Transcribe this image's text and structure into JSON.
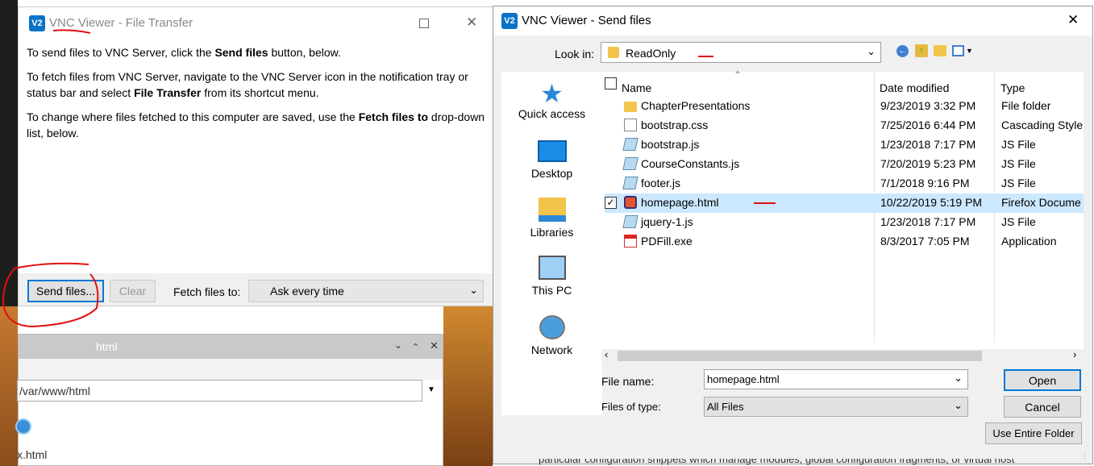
{
  "file_transfer": {
    "title": "VNC Viewer - File Transfer",
    "p1_pre": "To send files to VNC Server, click the ",
    "p1_bold": "Send files",
    "p1_post": " button, below.",
    "p2_pre": "To fetch files from VNC Server, navigate to the VNC Server icon in the notification tray or status bar and select ",
    "p2_bold": "File Transfer",
    "p2_post": " from its shortcut menu.",
    "p3_pre": "To change where files fetched to this computer are saved, use the ",
    "p3_bold": "Fetch files to",
    "p3_post": " drop-down list, below.",
    "send_button": "Send files...",
    "clear_button": "Clear",
    "fetch_label": "Fetch files to:",
    "fetch_value": "Ask every time"
  },
  "bg_window": {
    "title": "html",
    "path": "/var/www/html",
    "file_label": "x.html"
  },
  "send_files": {
    "title": "VNC Viewer - Send files",
    "look_in_label": "Look in:",
    "look_in_value": "ReadOnly",
    "sidebar": [
      {
        "label": "Quick access",
        "icon": "star-icon"
      },
      {
        "label": "Desktop",
        "icon": "desktop-icon"
      },
      {
        "label": "Libraries",
        "icon": "libraries-icon"
      },
      {
        "label": "This PC",
        "icon": "computer-icon"
      },
      {
        "label": "Network",
        "icon": "network-icon"
      }
    ],
    "columns": {
      "name": "Name",
      "date": "Date modified",
      "type": "Type"
    },
    "files": [
      {
        "name": "ChapterPresentations",
        "date": "9/23/2019 3:32 PM",
        "type": "File folder",
        "icon": "folder-icon"
      },
      {
        "name": "bootstrap.css",
        "date": "7/25/2016 6:44 PM",
        "type": "Cascading Style",
        "icon": "css-file-icon"
      },
      {
        "name": "bootstrap.js",
        "date": "1/23/2018 7:17 PM",
        "type": "JS File",
        "icon": "js-file-icon"
      },
      {
        "name": "CourseConstants.js",
        "date": "7/20/2019 5:23 PM",
        "type": "JS File",
        "icon": "js-file-icon"
      },
      {
        "name": "footer.js",
        "date": "7/1/2018 9:16 PM",
        "type": "JS File",
        "icon": "js-file-icon"
      },
      {
        "name": "homepage.html",
        "date": "10/22/2019 5:19 PM",
        "type": "Firefox Docume",
        "icon": "firefox-file-icon",
        "selected": true
      },
      {
        "name": "jquery-1.js",
        "date": "1/23/2018 7:17 PM",
        "type": "JS File",
        "icon": "js-file-icon"
      },
      {
        "name": "PDFill.exe",
        "date": "8/3/2017 7:05 PM",
        "type": "Application",
        "icon": "exe-file-icon"
      }
    ],
    "filename_label": "File name:",
    "filename_value": "homepage.html",
    "filetype_label": "Files of type:",
    "filetype_value": "All Files",
    "open_button": "Open",
    "cancel_button": "Cancel",
    "entire_folder_button": "Use Entire Folder"
  },
  "bottom_text": "particular configuration snippets which manage modules, global configuration fragments, or virtual host",
  "colors": {
    "annotation_red": "#e01010",
    "selected_row": "#cce8ff",
    "accent_blue": "#0078d7"
  }
}
